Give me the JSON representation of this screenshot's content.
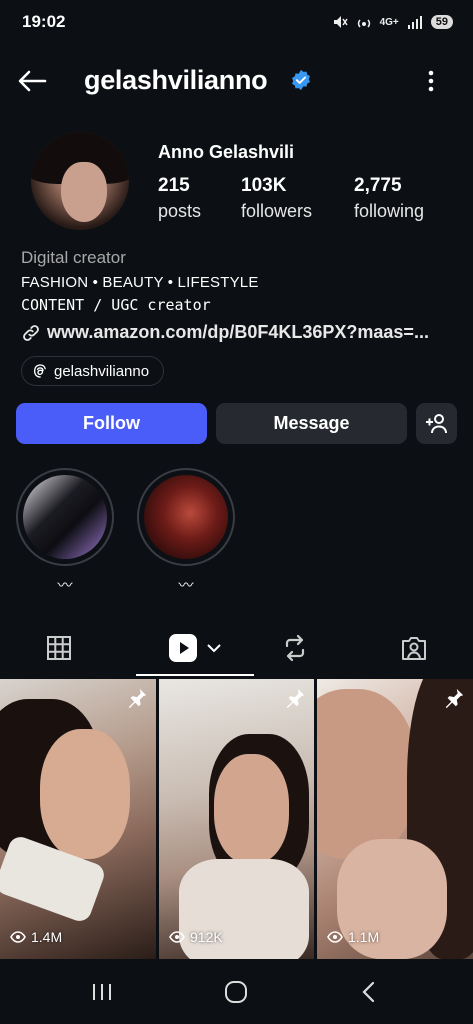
{
  "status_bar": {
    "time": "19:02",
    "network": "4G+",
    "battery": "59"
  },
  "profile": {
    "username": "gelashvilianno",
    "display_name": "Anno Gelashvili",
    "verified": true,
    "stats": [
      {
        "value": "215",
        "label": "posts"
      },
      {
        "value": "103K",
        "label": "followers"
      },
      {
        "value": "2,775",
        "label": "following"
      }
    ],
    "bio": {
      "category": "Digital creator",
      "line1": "FASHION • BEAUTY • LIFESTYLE",
      "line2": "CONTENT / UGC creator",
      "link": "www.amazon.com/dp/B0F4KL36PX?maas=..."
    },
    "threads_handle": "gelashvilianno"
  },
  "actions": {
    "follow": "Follow",
    "message": "Message"
  },
  "highlights": [
    {
      "label": "〰"
    },
    {
      "label": "〰"
    }
  ],
  "tabs": [
    "grid",
    "reels",
    "reposts",
    "tagged"
  ],
  "reels": [
    {
      "views": "1.4M",
      "pinned": true
    },
    {
      "views": "912K",
      "pinned": true
    },
    {
      "views": "1.1M",
      "pinned": true
    }
  ],
  "colors": {
    "background": "#0c1014",
    "follow_button": "#4a5df9",
    "secondary_button": "#262a30",
    "verified_badge": "#3897f0"
  }
}
